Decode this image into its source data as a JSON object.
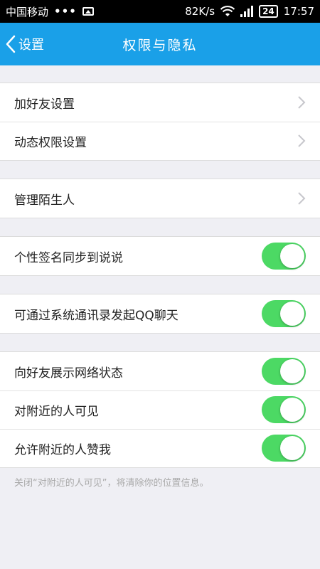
{
  "status_bar": {
    "carrier": "中国移动",
    "signal_dots": "•••",
    "speed": "82K/s",
    "battery": "24",
    "time": "17:57"
  },
  "header": {
    "back_label": "设置",
    "title": "权限与隐私"
  },
  "groups": {
    "g1": {
      "items": [
        {
          "label": "加好友设置"
        },
        {
          "label": "动态权限设置"
        }
      ]
    },
    "g2": {
      "items": [
        {
          "label": "管理陌生人"
        }
      ]
    },
    "g3": {
      "items": [
        {
          "label": "个性签名同步到说说",
          "on": true
        }
      ]
    },
    "g4": {
      "items": [
        {
          "label": "可通过系统通讯录发起QQ聊天",
          "on": true
        }
      ]
    },
    "g5": {
      "items": [
        {
          "label": "向好友展示网络状态",
          "on": true
        },
        {
          "label": "对附近的人可见",
          "on": true
        },
        {
          "label": "允许附近的人赞我",
          "on": true
        }
      ]
    }
  },
  "footnote": "关闭“对附近的人可见”，将清除你的位置信息。",
  "colors": {
    "header": "#1aa0e8",
    "toggle_on": "#4cd964"
  }
}
